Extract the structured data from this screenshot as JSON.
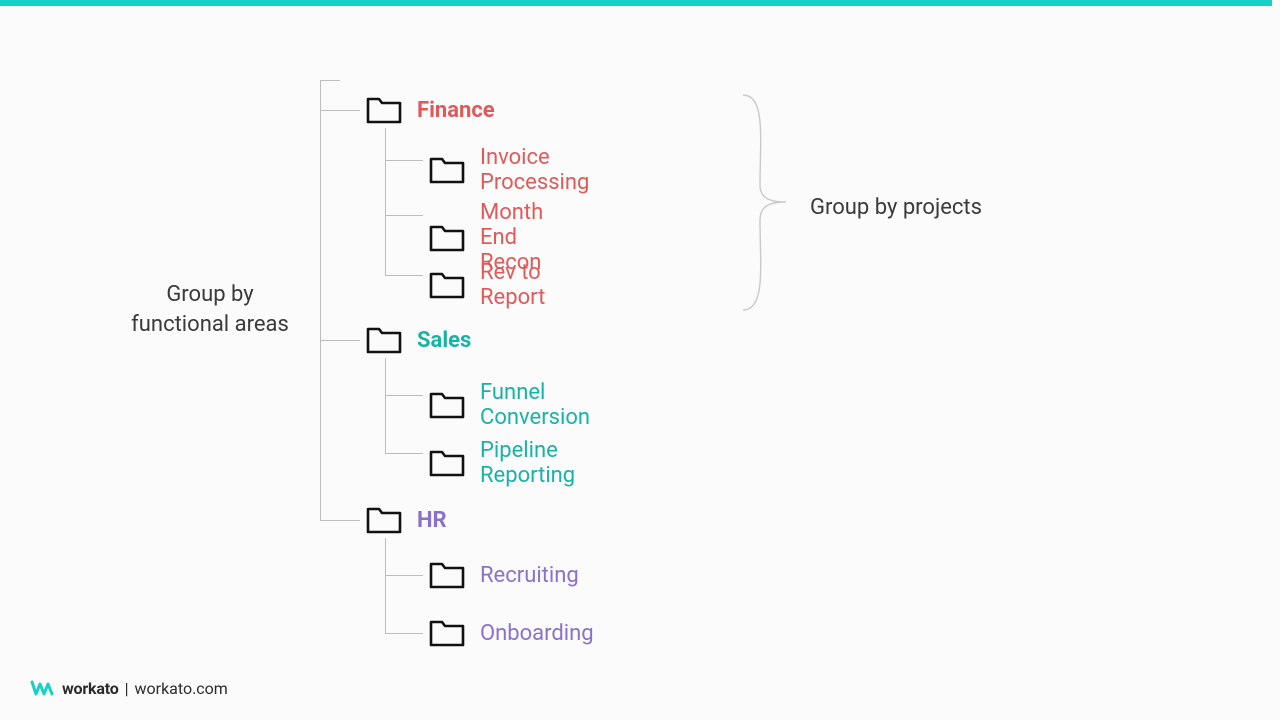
{
  "annotations": {
    "left_line1": "Group by",
    "left_line2": "functional areas",
    "right": "Group by projects"
  },
  "tree": {
    "finance": {
      "label": "Finance",
      "items": [
        "Invoice Processing",
        "Month End Recon",
        "Rev to Report"
      ]
    },
    "sales": {
      "label": "Sales",
      "items": [
        "Funnel Conversion",
        "Pipeline Reporting"
      ]
    },
    "hr": {
      "label": "HR",
      "items": [
        "Recruiting",
        "Onboarding"
      ]
    }
  },
  "footer": {
    "brand": "workato",
    "separator": " | ",
    "url": "workato.com"
  },
  "colors": {
    "accent_bar": "#16d1c6",
    "finance": "#e05a5a",
    "sales": "#18b3a7",
    "hr": "#8a72c9"
  }
}
